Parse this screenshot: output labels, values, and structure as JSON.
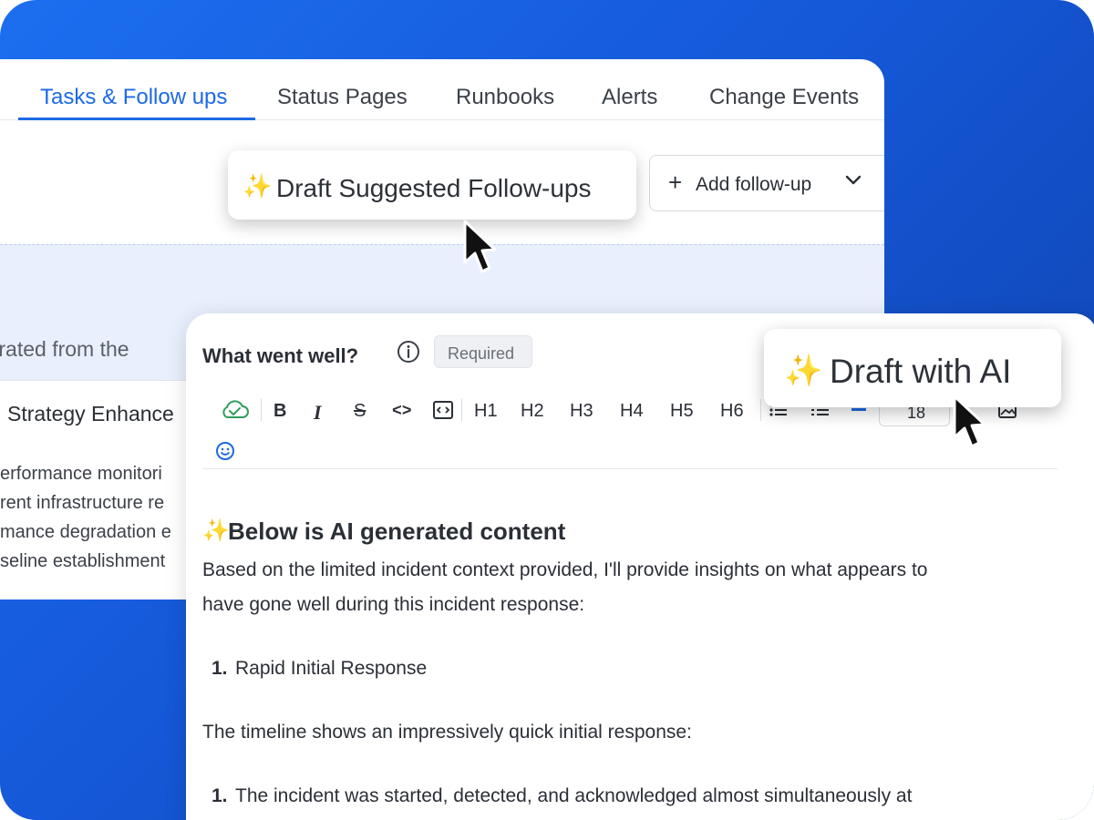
{
  "tabs": [
    {
      "label": "Tasks & Follow ups",
      "active": true
    },
    {
      "label": "Status Pages",
      "active": false
    },
    {
      "label": "Runbooks",
      "active": false
    },
    {
      "label": "Alerts",
      "active": false
    },
    {
      "label": "Change Events",
      "active": false
    }
  ],
  "draft_followups": {
    "icon": "sparkles-icon",
    "emoji": "✨",
    "label": "Draft Suggested Follow-ups"
  },
  "add_followup": {
    "label": "Add follow-up"
  },
  "background_panel": {
    "generated_text": "enerated from the",
    "followup_title": "Strategy Enhance",
    "lines": [
      "erformance monitori",
      "rent infrastructure re",
      "mance degradation e",
      "seline establishment"
    ]
  },
  "editor": {
    "question": "What went well?",
    "required_label": "Required",
    "toolbar": {
      "bold": "B",
      "italic": "I",
      "strike": "S",
      "code": "<>",
      "headings": [
        "H1",
        "H2",
        "H3",
        "H4",
        "H5",
        "H6"
      ],
      "font_size": "18"
    },
    "ai_heading_emoji": "✨",
    "ai_heading": "Below is AI generated content",
    "paragraph1_line1": "Based on the limited incident context provided, I'll provide insights on what appears to",
    "paragraph1_line2": "have gone well during this incident response:",
    "list1": {
      "number": "1.",
      "text": "Rapid Initial Response"
    },
    "paragraph2": "The timeline shows an impressively quick initial response:",
    "list2": {
      "number": "1.",
      "text": "The incident was started, detected, and acknowledged almost simultaneously at"
    }
  },
  "draft_ai": {
    "icon": "sparkles-icon",
    "emoji": "✨",
    "label": "Draft with AI"
  },
  "colors": {
    "accent": "#1d6ae5",
    "background_gradient_start": "#1c6ff0",
    "background_gradient_end": "#0e3fa6",
    "sync_icon": "#2e9e5b"
  }
}
